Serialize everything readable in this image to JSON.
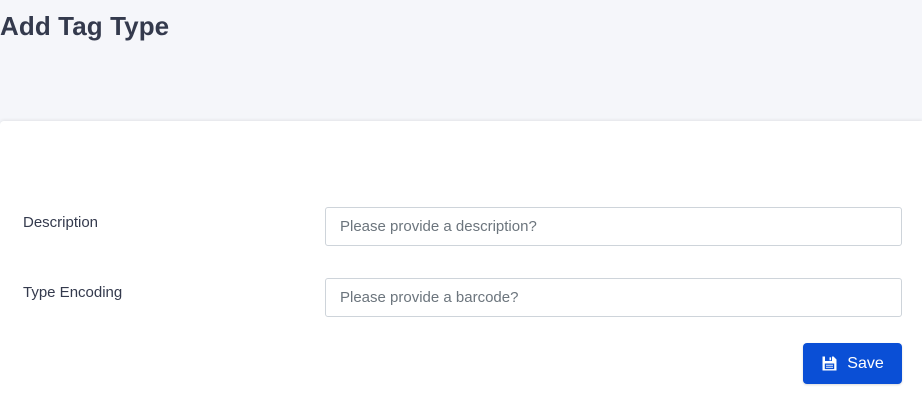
{
  "header": {
    "title": "Add Tag Type"
  },
  "form": {
    "description": {
      "label": "Description",
      "value": "",
      "placeholder": "Please provide a description?"
    },
    "type_encoding": {
      "label": "Type Encoding",
      "value": "",
      "placeholder": "Please provide a barcode?"
    },
    "save_button": {
      "label": "Save",
      "icon": "floppy-disk-icon",
      "color": "#0a4fd6"
    }
  },
  "colors": {
    "page_background": "#f5f6fa",
    "card_background": "#ffffff",
    "text": "#343a4d",
    "accent": "#0a4fd6"
  }
}
